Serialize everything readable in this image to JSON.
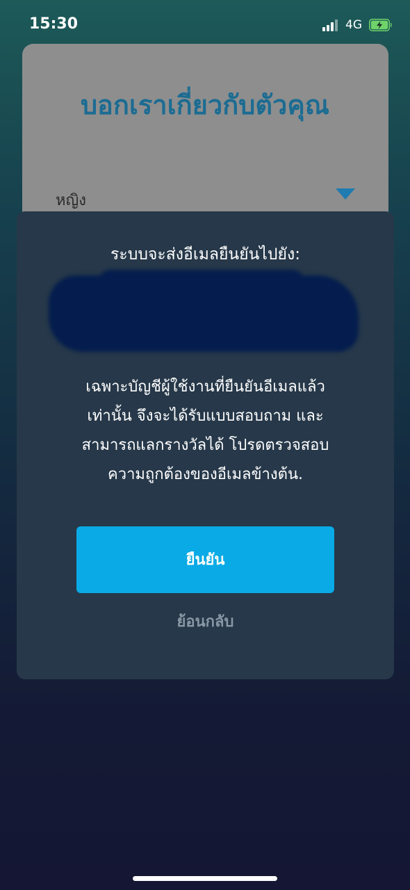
{
  "status_bar": {
    "time": "15:30",
    "network": "4G",
    "icons": [
      "signal-icon",
      "battery-charging-icon"
    ]
  },
  "background_form": {
    "title": "บอกเราเกี่ยวกับตัวคุณ",
    "gender_value": "หญิง",
    "icons": [
      "dropdown-arrow-icon"
    ]
  },
  "dialog": {
    "heading": "ระบบจะส่งอีเมลยืนยันไปยัง:",
    "message_lines": [
      "เฉพาะบัญชีผู้ใช้งานที่ยืนยันอีเมลแล้ว",
      "เท่านั้น จึงจะได้รับแบบสอบถาม และ",
      "สามารถแลกรางวัลได้ โปรดตรวจสอบ",
      "ความถูกต้องของอีเมลข้างต้น."
    ],
    "confirm_label": "ยืนยัน",
    "back_label": "ย้อนกลับ"
  },
  "colors": {
    "accent": "#0aaae6",
    "title_blue": "#1c6c92",
    "dialog_bg": "#263849",
    "redaction": "#041d4e"
  }
}
